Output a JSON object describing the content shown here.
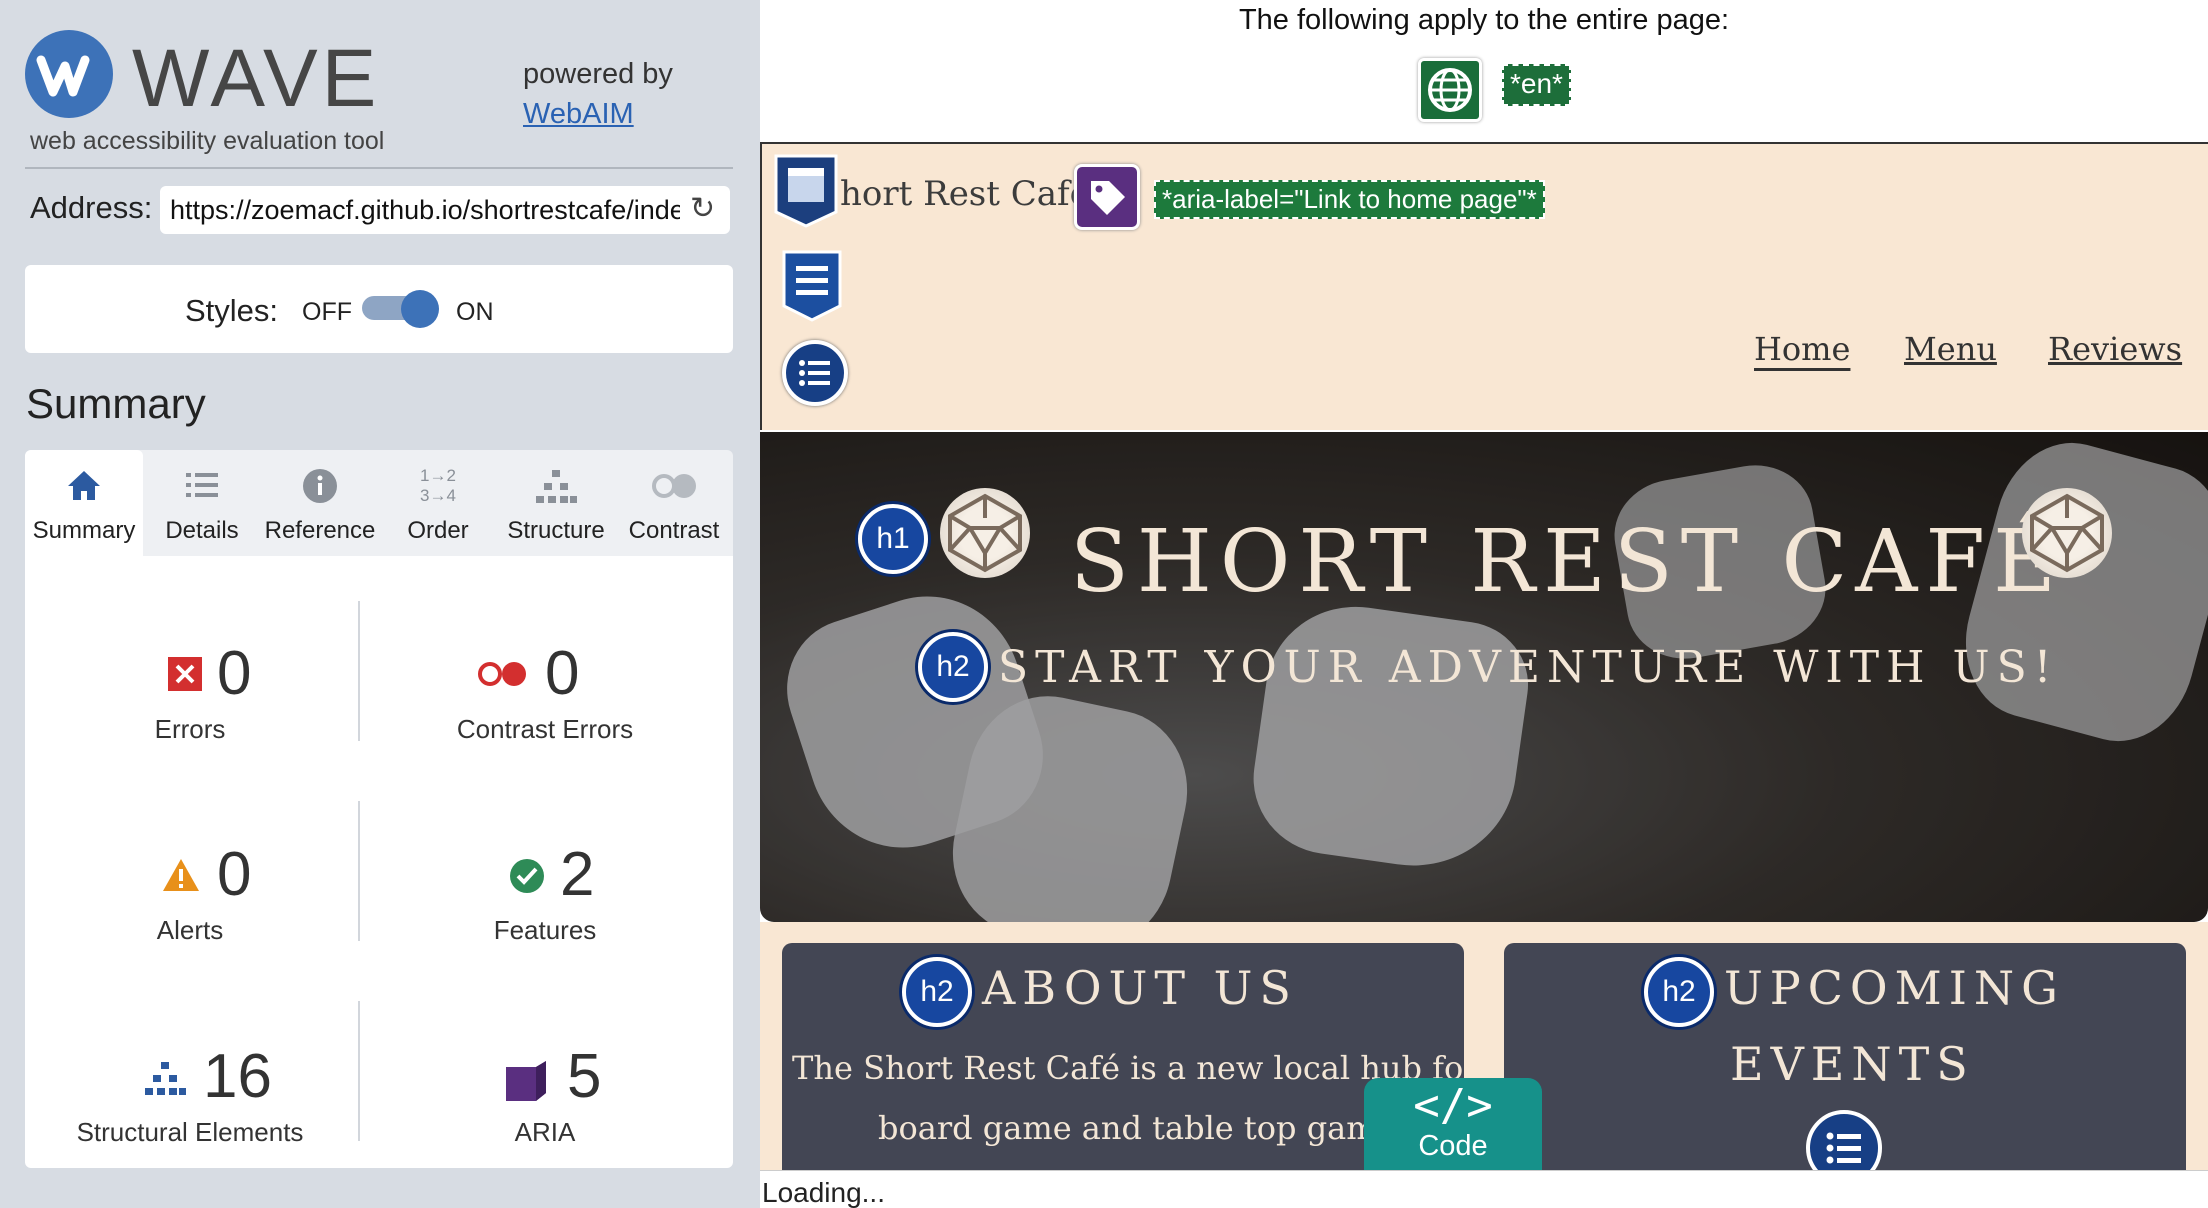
{
  "sidebar": {
    "logo_text": "WAVE",
    "tagline": "web accessibility evaluation tool",
    "powered_by": "powered by",
    "webaim_link": "WebAIM",
    "address_label": "Address:",
    "address_value": "https://zoemacf.github.io/shortrestcafe/inde",
    "styles_label": "Styles:",
    "styles_off": "OFF",
    "styles_on": "ON",
    "styles_enabled": true,
    "summary_heading": "Summary",
    "tabs": [
      {
        "label": "Summary",
        "icon": "home-icon",
        "active": true
      },
      {
        "label": "Details",
        "icon": "list-icon",
        "active": false
      },
      {
        "label": "Reference",
        "icon": "info-icon",
        "active": false
      },
      {
        "label": "Order",
        "icon": "order-icon",
        "active": false
      },
      {
        "label": "Structure",
        "icon": "structure-icon",
        "active": false
      },
      {
        "label": "Contrast",
        "icon": "contrast-icon",
        "active": false
      }
    ],
    "stats": [
      {
        "label": "Errors",
        "count": "0",
        "icon": "error-icon",
        "color": "#d32f2f"
      },
      {
        "label": "Contrast Errors",
        "count": "0",
        "icon": "contrast-error-icon",
        "color": "#d32f2f"
      },
      {
        "label": "Alerts",
        "count": "0",
        "icon": "alert-icon",
        "color": "#e8901a"
      },
      {
        "label": "Features",
        "count": "2",
        "icon": "feature-icon",
        "color": "#2e8b57"
      },
      {
        "label": "Structural Elements",
        "count": "16",
        "icon": "structure-icon",
        "color": "#2c5aa0"
      },
      {
        "label": "ARIA",
        "count": "5",
        "icon": "aria-icon",
        "color": "#5a2f80"
      }
    ]
  },
  "main": {
    "page_note": "The following apply to the entire page:",
    "lang_badge": "*en*",
    "site_brand": "hort Rest Cafe",
    "aria_label_badge": "*aria-label=\"Link to home page\"*",
    "nav": [
      {
        "label": "Home"
      },
      {
        "label": "Menu"
      },
      {
        "label": "Reviews"
      }
    ],
    "hero_h1_badge": "h1",
    "hero_title": "SHORT REST CAFÉ",
    "hero_h2_badge": "h2",
    "hero_subtitle": "START YOUR ADVENTURE WITH US!",
    "about_badge": "h2",
    "about_title": "ABOUT US",
    "about_line1": "The Short Rest Café is a new local hub for the",
    "about_line2": "board game and table top gaming",
    "events_badge": "h2",
    "events_title_1": "UPCOMING",
    "events_title_2": "EVENTS",
    "code_glyph": "</>",
    "code_label": "Code",
    "status_text": "Loading..."
  },
  "colors": {
    "accent": "#3d72b8",
    "header_bg": "#f9e7d3",
    "card_bg": "#434654",
    "code_button": "#16918a"
  }
}
